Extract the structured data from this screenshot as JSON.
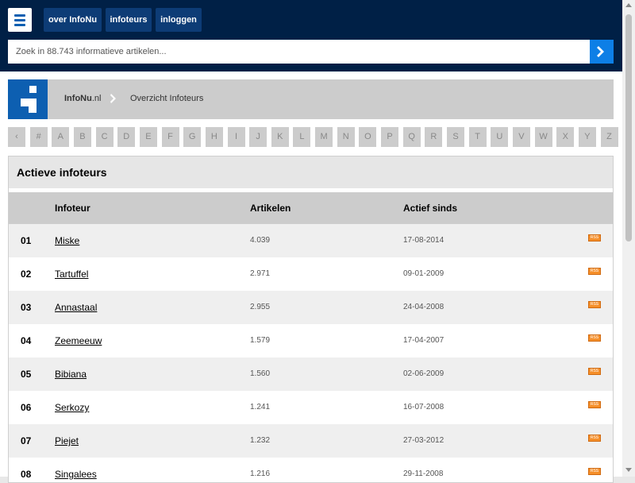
{
  "header": {
    "menu_icon": "hamburger-icon",
    "nav": [
      {
        "label": "over InfoNu"
      },
      {
        "label": "infoteurs"
      },
      {
        "label": "inloggen"
      }
    ],
    "search": {
      "placeholder": "Zoek in 88.743 informatieve artikelen...",
      "value": ""
    }
  },
  "breadcrumb": {
    "home_bold": "InfoNu",
    "home_suffix": ".nl",
    "current": "Overzicht Infoteurs"
  },
  "alphabet": [
    "‹",
    "#",
    "A",
    "B",
    "C",
    "D",
    "E",
    "F",
    "G",
    "H",
    "I",
    "J",
    "K",
    "L",
    "M",
    "N",
    "O",
    "P",
    "Q",
    "R",
    "S",
    "T",
    "U",
    "V",
    "W",
    "X",
    "Y",
    "Z"
  ],
  "panel": {
    "title": "Actieve infoteurs",
    "columns": {
      "name": "Infoteur",
      "articles": "Artikelen",
      "since": "Actief sinds"
    },
    "rows": [
      {
        "rank": "01",
        "name": "Miske",
        "articles": "4.039",
        "since": "17-08-2014"
      },
      {
        "rank": "02",
        "name": "Tartuffel",
        "articles": "2.971",
        "since": "09-01-2009"
      },
      {
        "rank": "03",
        "name": "Annastaal",
        "articles": "2.955",
        "since": "24-04-2008"
      },
      {
        "rank": "04",
        "name": "Zeemeeuw",
        "articles": "1.579",
        "since": "17-04-2007"
      },
      {
        "rank": "05",
        "name": "Bibiana",
        "articles": "1.560",
        "since": "02-06-2009"
      },
      {
        "rank": "06",
        "name": "Serkozy",
        "articles": "1.241",
        "since": "16-07-2008"
      },
      {
        "rank": "07",
        "name": "Piejet",
        "articles": "1.232",
        "since": "27-03-2012"
      },
      {
        "rank": "08",
        "name": "Singalees",
        "articles": "1.216",
        "since": "29-11-2008"
      }
    ],
    "rss_label": "RSS"
  },
  "colors": {
    "header_bg": "#002046",
    "nav_btn": "#0d3c76",
    "accent": "#0d7fe6",
    "rss": "#f58f2a"
  }
}
